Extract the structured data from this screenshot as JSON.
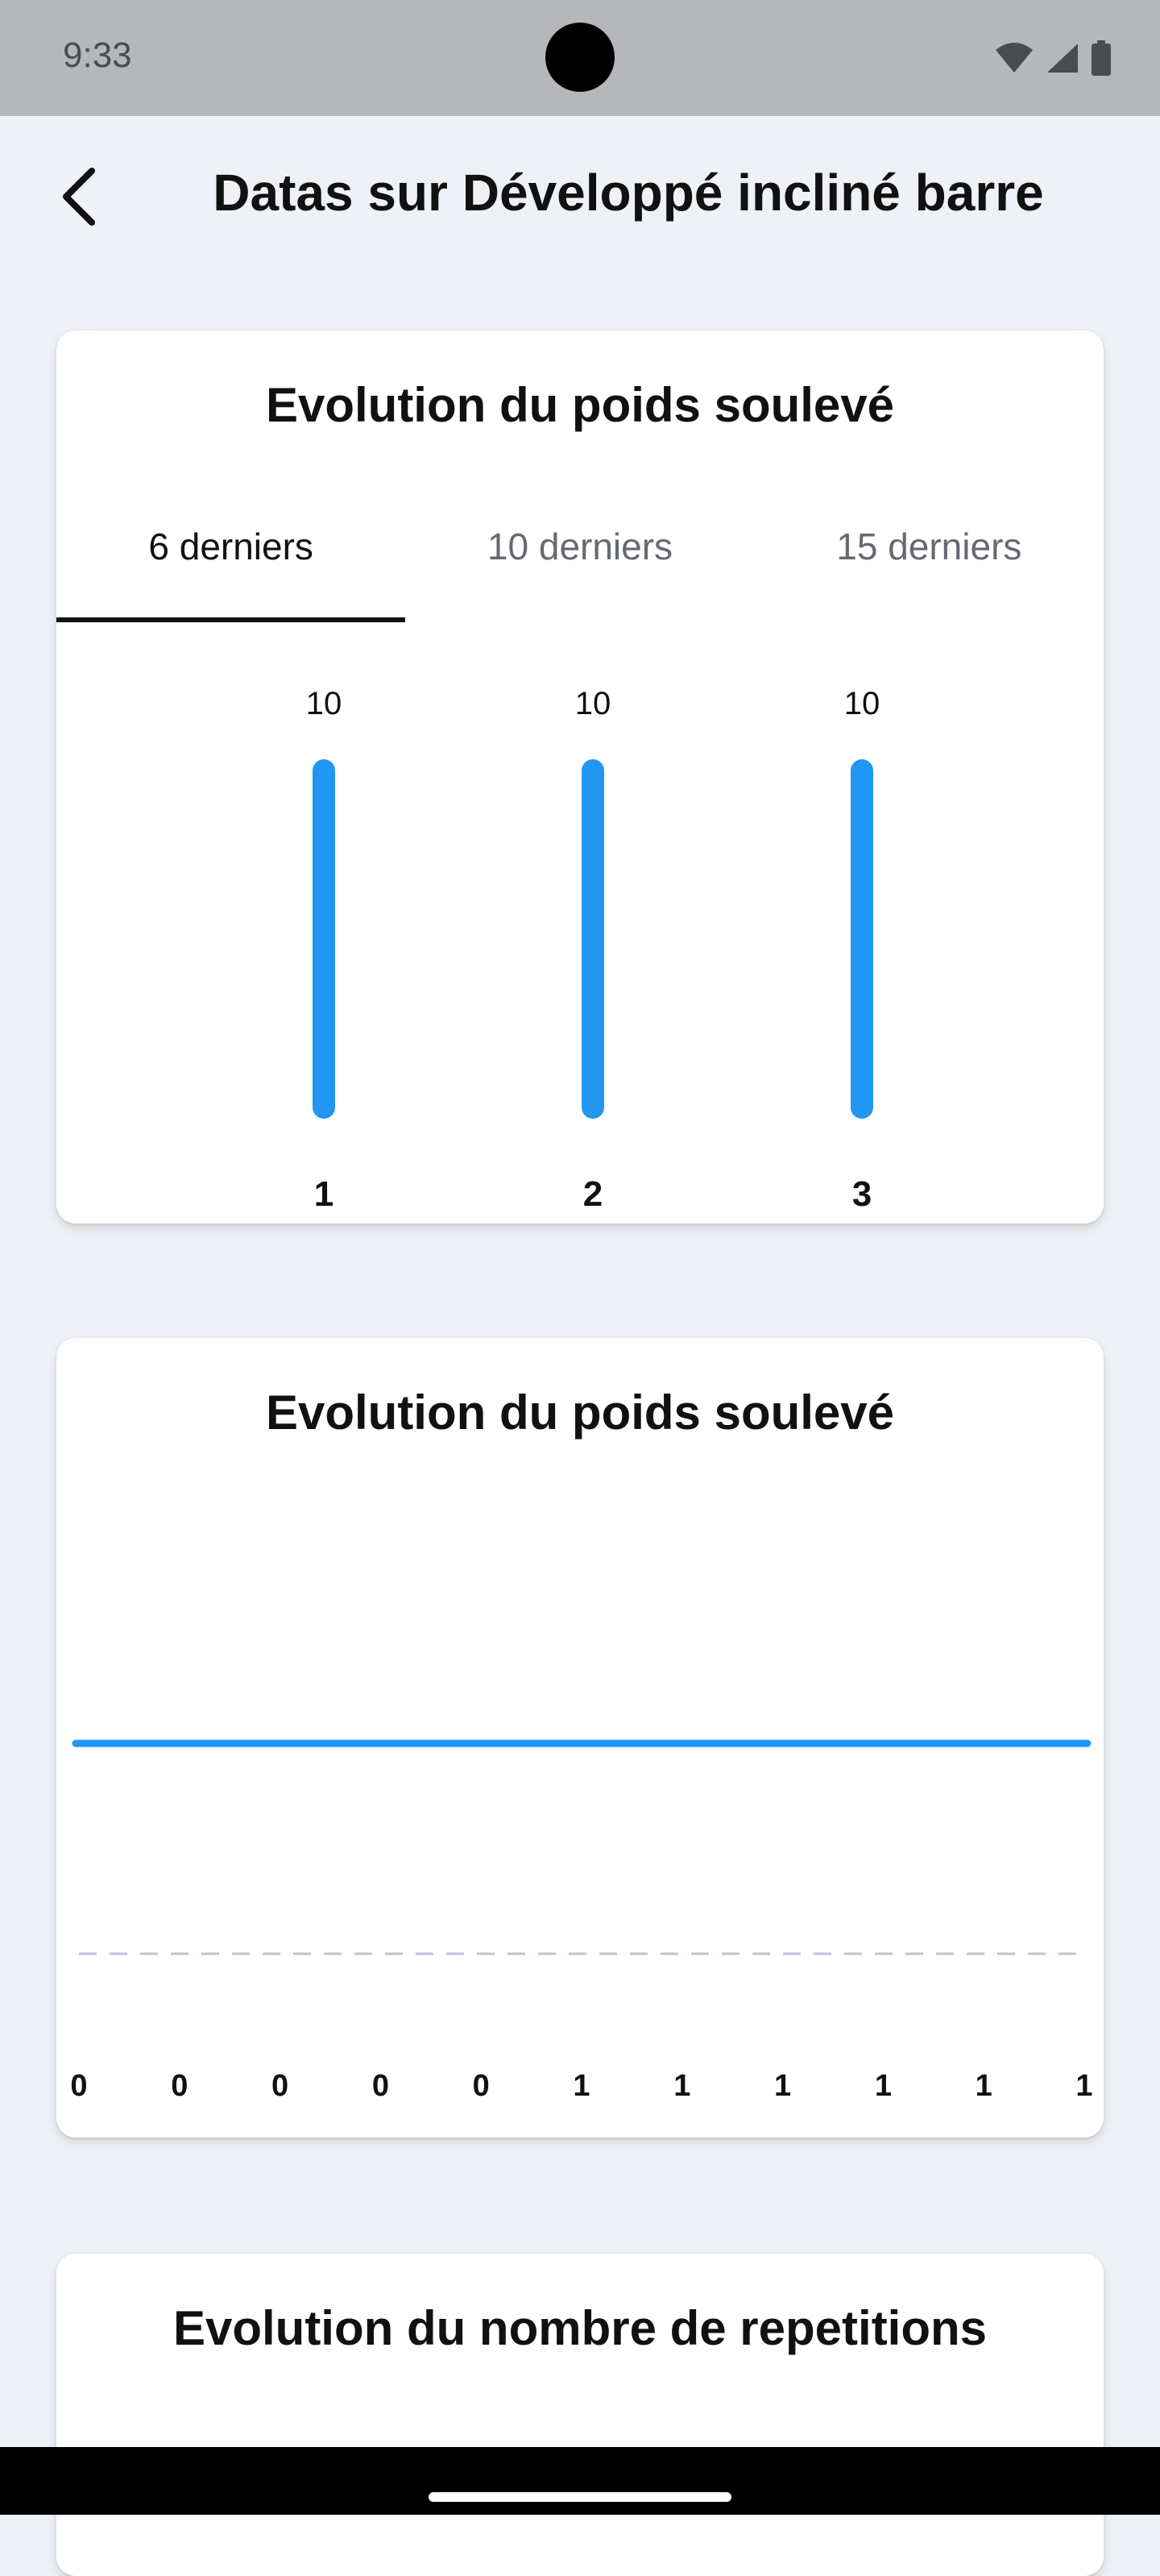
{
  "status_bar": {
    "time": "9:33"
  },
  "header": {
    "title": "Datas sur Développé incliné barre"
  },
  "card1": {
    "title": "Evolution du poids soulevé",
    "tabs": [
      {
        "label": "6 derniers",
        "active": true
      },
      {
        "label": "10 derniers",
        "active": false
      },
      {
        "label": "15 derniers",
        "active": false
      }
    ]
  },
  "card2": {
    "title": "Evolution du poids soulevé"
  },
  "card3": {
    "title": "Evolution du nombre de repetitions"
  },
  "colors": {
    "accent": "#2196f3",
    "background": "#eef1f6",
    "dashed_grid": "#b8c7d6"
  },
  "chart_data": [
    {
      "type": "bar",
      "categories": [
        "1",
        "2",
        "3"
      ],
      "values": [
        10,
        10,
        10
      ],
      "data_labels": [
        "10",
        "10",
        "10"
      ],
      "title": "Evolution du poids soulevé",
      "ylim": [
        0,
        10
      ]
    },
    {
      "type": "line",
      "x": [
        "0",
        "0",
        "0",
        "0",
        "0",
        "1",
        "1",
        "1",
        "1",
        "1",
        "1"
      ],
      "series": [
        {
          "values": [
            10,
            10,
            10,
            10,
            10,
            10,
            10,
            10,
            10,
            10,
            10
          ]
        }
      ],
      "reference_line": "dashed",
      "title": "Evolution du poids soulevé"
    }
  ]
}
